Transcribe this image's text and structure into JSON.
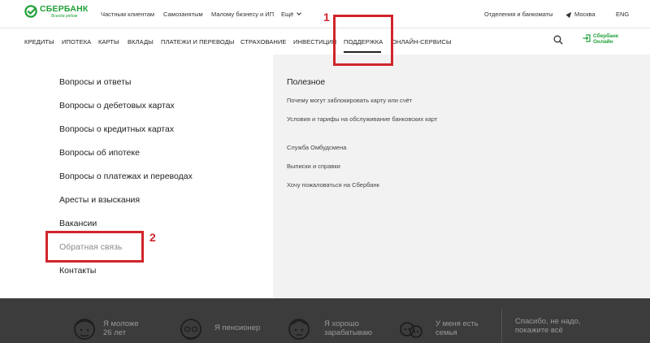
{
  "brand": {
    "name": "СБЕРБАНК",
    "tagline": "Всегда рядом",
    "color": "#21a038"
  },
  "top_links": {
    "private": "Частным клиентам",
    "selfemployed": "Самозанятым",
    "business": "Малому бизнесу и ИП",
    "more": "Ещё",
    "branches": "Отделения и банкоматы",
    "city": "Москва",
    "lang": "ENG"
  },
  "nav": {
    "items": [
      "КРЕДИТЫ",
      "ИПОТЕКА",
      "КАРТЫ",
      "ВКЛАДЫ",
      "ПЛАТЕЖИ И ПЕРЕВОДЫ",
      "СТРАХОВАНИЕ",
      "ИНВЕСТИЦИИ",
      "ПОДДЕРЖКА",
      "ОНЛАЙН-СЕРВИСЫ"
    ],
    "active": "ПОДДЕРЖКА",
    "sberbank_online_line1": "Сбербанк",
    "sberbank_online_line2": "Онлайн"
  },
  "support_menu": {
    "links": [
      "Вопросы и ответы",
      "Вопросы о дебетовых картах",
      "Вопросы о кредитных картах",
      "Вопросы об ипотеке",
      "Вопросы о платежах и переводах",
      "Аресты и взыскания",
      "Вакансии",
      "Обратная связь",
      "Контакты"
    ],
    "useful_title": "Полезное",
    "useful_links": [
      "Почему могут заблокировать карту или счёт",
      "Условия и тарифы на обслуживание банковских карт",
      "Служба Омбудсмена",
      "Выписки и справки",
      "Хочу пожаловаться на Сбербанк"
    ]
  },
  "annotations": {
    "label_1": "1",
    "label_2": "2",
    "color": "#d0252b"
  },
  "bottom_band": {
    "options": [
      "Я моложе\n26 лет",
      "Я пенсионер",
      "Я хорошо\nзарабатываю",
      "У меня есть\nсемья"
    ],
    "dismiss": "Спасибо, не надо,\nпокажите всё"
  }
}
